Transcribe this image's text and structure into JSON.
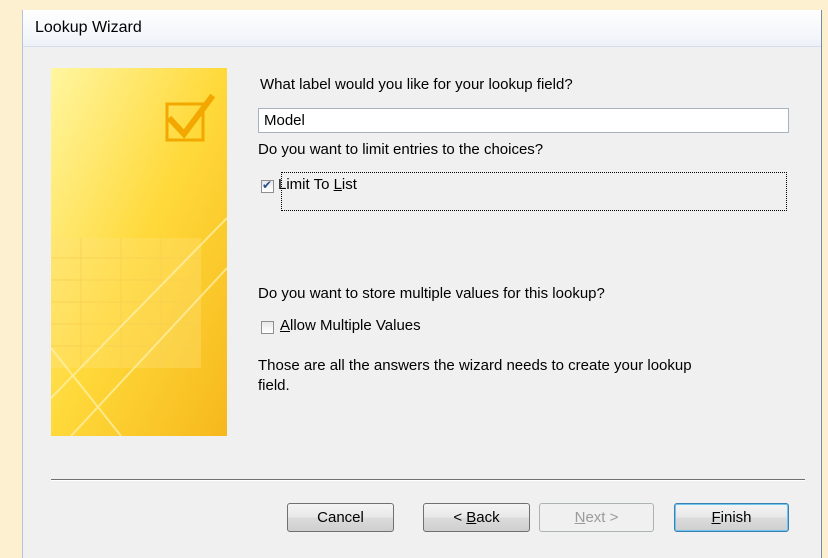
{
  "window": {
    "title": "Lookup Wizard"
  },
  "form": {
    "label_question": "What label would you like for your lookup field?",
    "label_value": "Model",
    "limit_question": "Do you want to limit entries to the choices?",
    "limit_checkbox": {
      "label": "Limit To List",
      "mnemonic": "L",
      "checked": true
    },
    "multi_question": "Do you want to store multiple values for this lookup?",
    "multi_checkbox": {
      "label": "Allow Multiple Values",
      "mnemonic": "A",
      "checked": false
    },
    "closing_line1": "Those are all the answers the wizard needs to create your lookup",
    "closing_line2": "field."
  },
  "buttons": {
    "cancel": "Cancel",
    "back": "< Back",
    "next": "Next >",
    "finish": "Finish"
  },
  "colors": {
    "art_yellow": "#ffd93a",
    "dialog_bg": "#f0f0f0",
    "page_bg": "#fdf0d0"
  }
}
